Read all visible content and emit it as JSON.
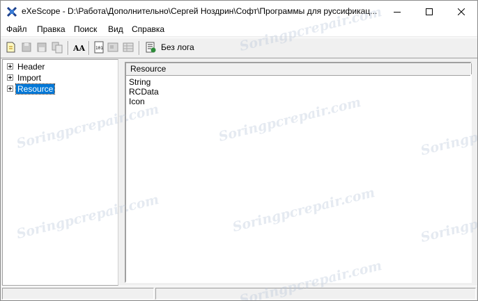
{
  "window": {
    "title": "eXeScope - D:\\Работа\\Дополнительно\\Сергей Ноздрин\\Софт\\Программы для руссификац..."
  },
  "menu": [
    "Файл",
    "Правка",
    "Поиск",
    "Вид",
    "Справка"
  ],
  "toolbar": {
    "log_label": "Без лога"
  },
  "tree": {
    "items": [
      {
        "label": "Header",
        "selected": false
      },
      {
        "label": "Import",
        "selected": false
      },
      {
        "label": "Resource",
        "selected": true
      }
    ]
  },
  "list": {
    "header": "Resource",
    "rows": [
      "String",
      "RCData",
      "Icon"
    ]
  },
  "watermark": {
    "text": "Soringpcrepair.com"
  },
  "colors": {
    "selection": "#0078d7",
    "toolbar_bg": "#f0f0f0"
  }
}
